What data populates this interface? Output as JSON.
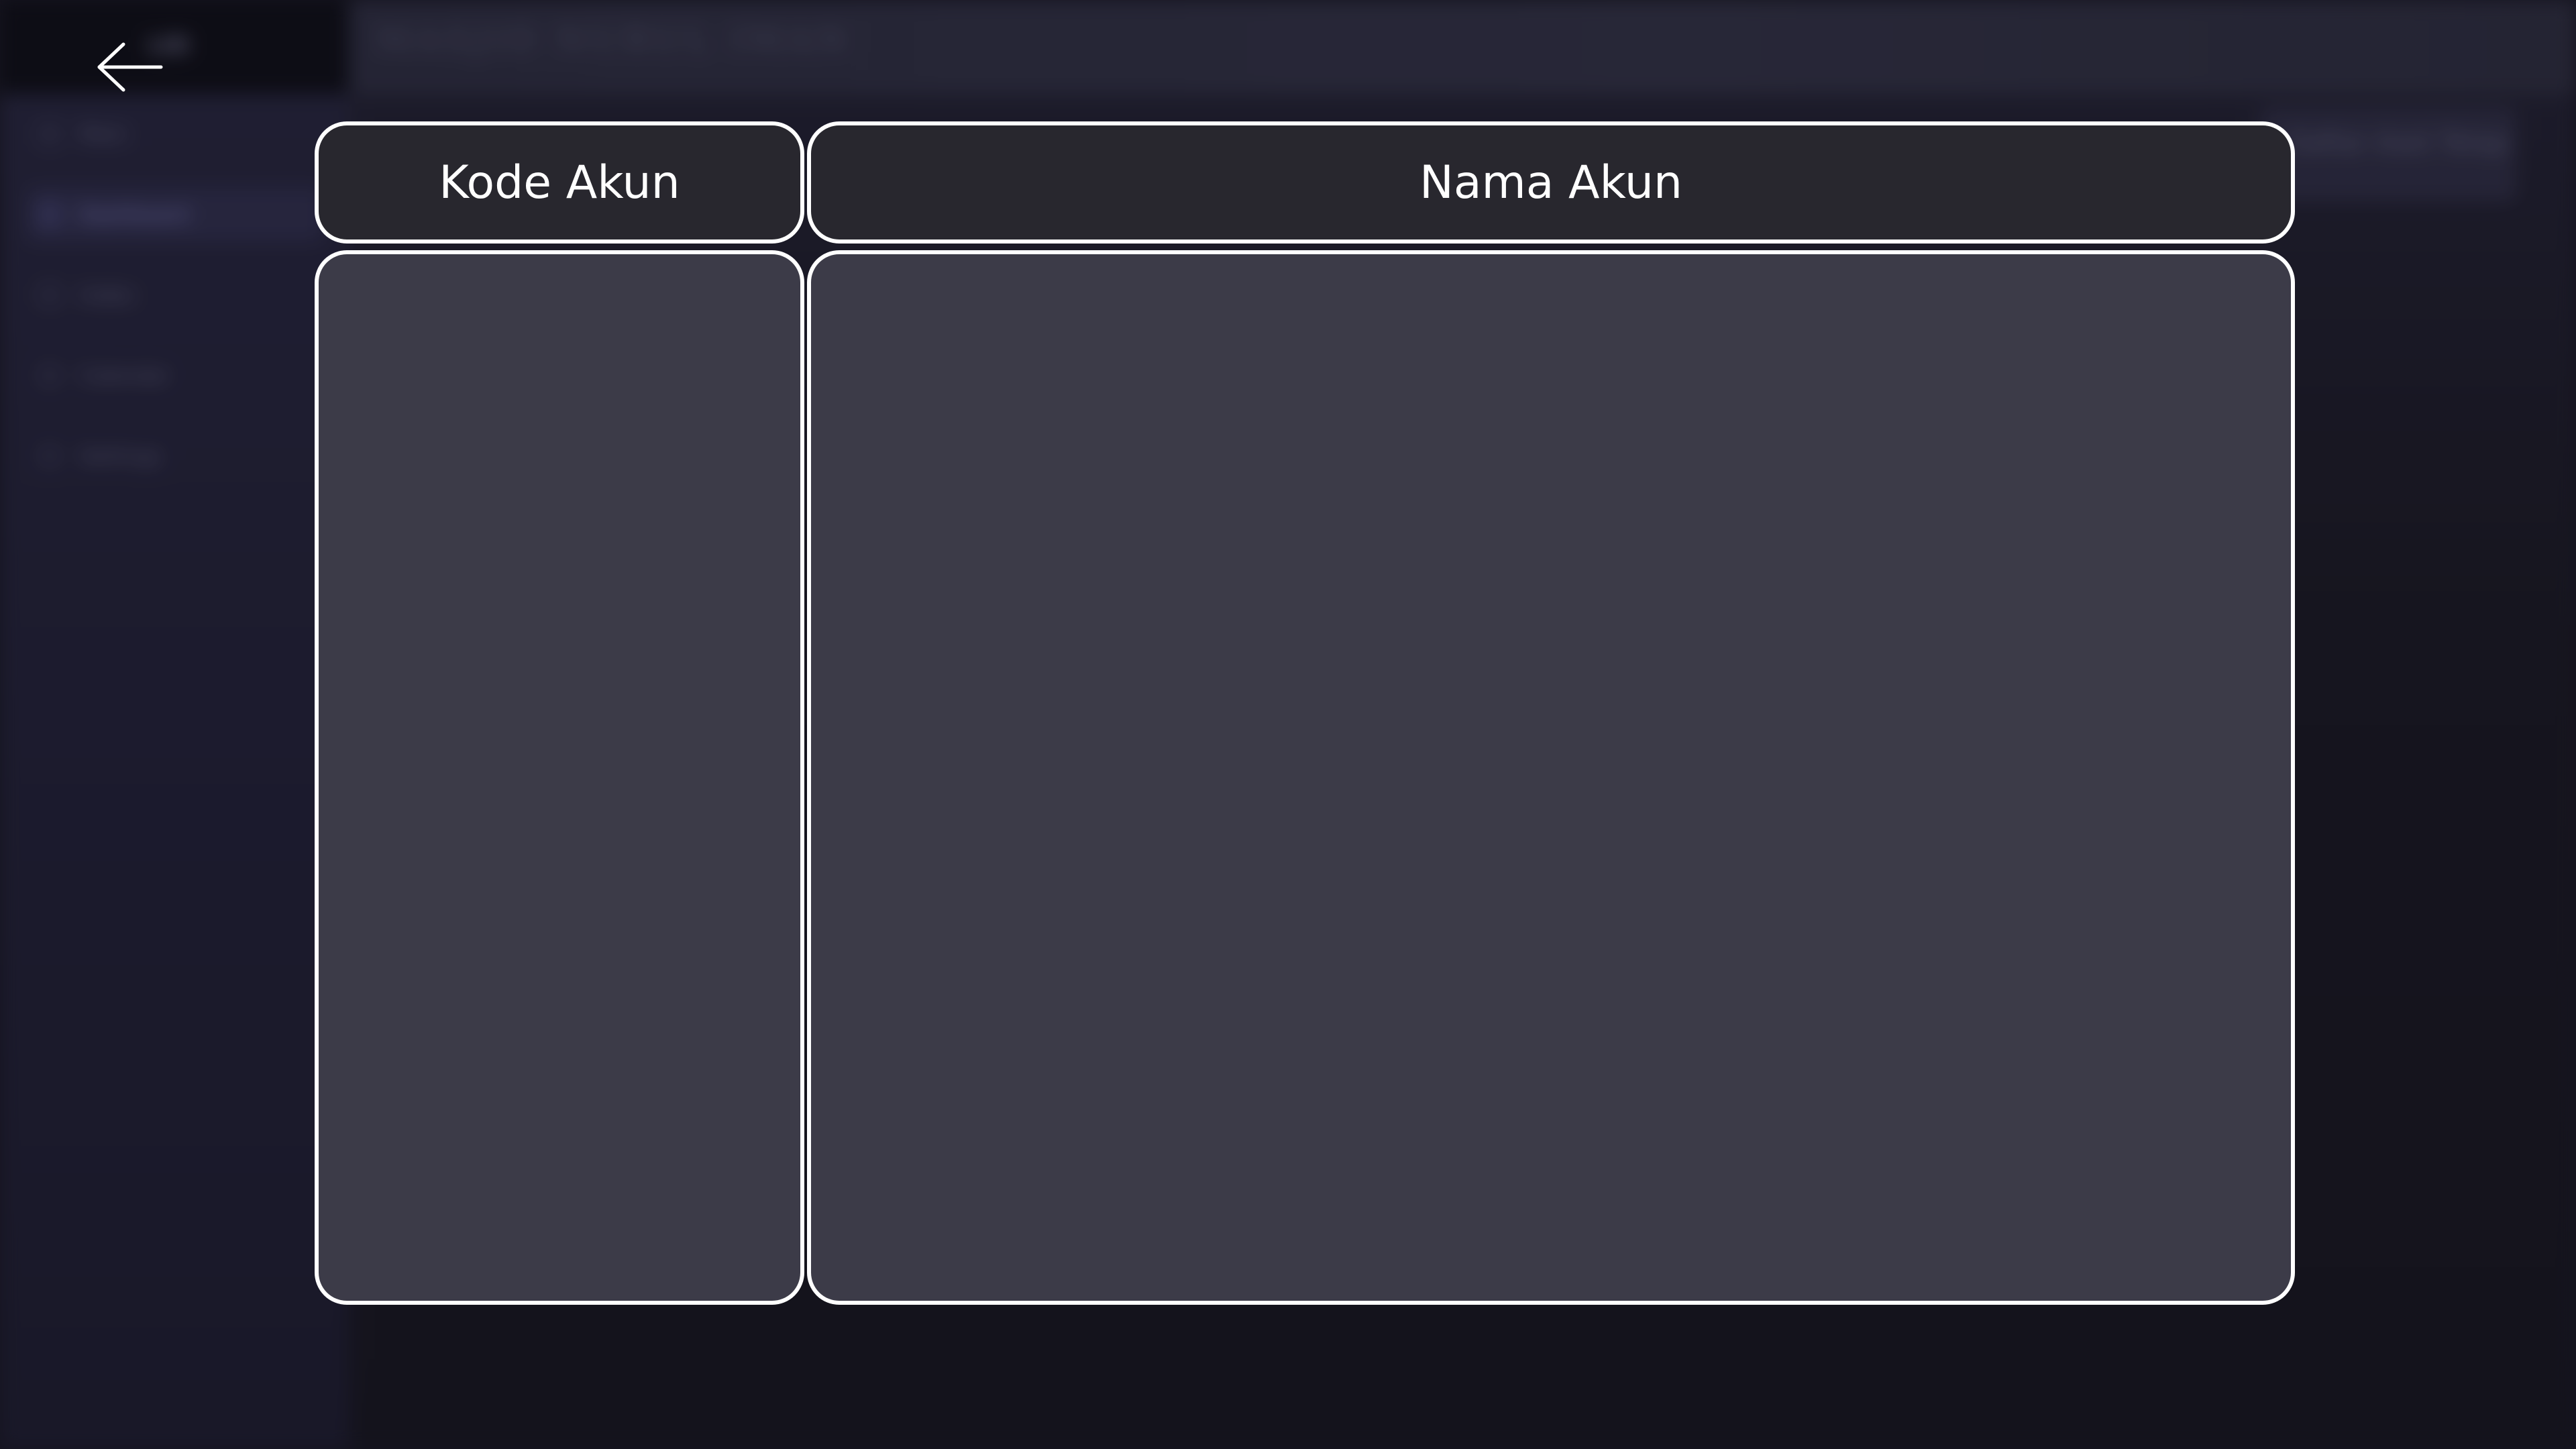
{
  "background_app": {
    "sidebar_header": "LID",
    "topbar_title": "MASJID NURUL IMAN",
    "nav_items": [
      {
        "label": "Main"
      },
      {
        "label": "Dashboard"
      },
      {
        "label": "Index"
      },
      {
        "label": "Calendar"
      },
      {
        "label": "Settings"
      }
    ],
    "top_right_chip": "Daftar Aset Tetap"
  },
  "table": {
    "columns": [
      {
        "label": "Kode Akun"
      },
      {
        "label": "Nama Akun"
      }
    ],
    "rows": []
  },
  "colors": {
    "header_fill": "#28272e",
    "body_fill": "#3c3b48",
    "border": "#ffffff",
    "text": "#ffffff"
  }
}
